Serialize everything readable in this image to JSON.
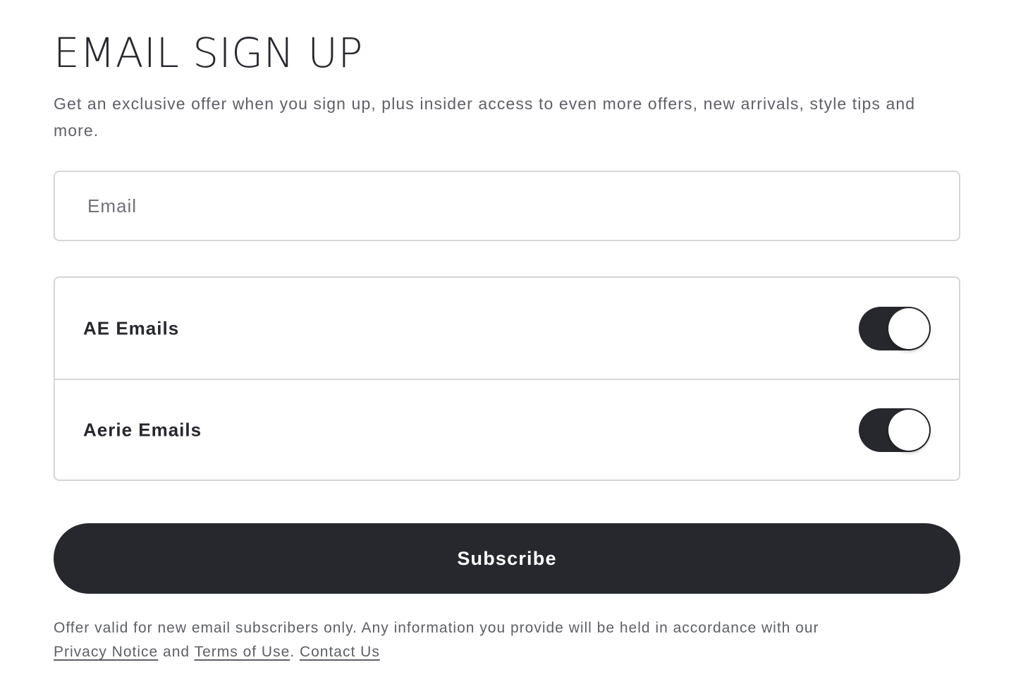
{
  "header": {
    "title": "EMAIL SIGN UP",
    "intro": "Get an exclusive offer when you sign up, plus insider access to even more offers, new arrivals, style tips and more."
  },
  "email_input": {
    "value": "",
    "placeholder": "Email"
  },
  "preferences": [
    {
      "label": "AE Emails",
      "enabled": true
    },
    {
      "label": "Aerie Emails",
      "enabled": true
    }
  ],
  "subscribe": {
    "label": "Subscribe"
  },
  "disclaimer": {
    "text": "Offer valid for new email subscribers only. Any information you provide will be held in accordance with our",
    "privacy_link": "Privacy Notice",
    "and_text": "and",
    "terms_link": "Terms of Use",
    "period": ".",
    "contact_link": "Contact Us"
  },
  "colors": {
    "primary": "#26282d",
    "border": "#d5d6d8",
    "muted_text": "#5e6066"
  }
}
